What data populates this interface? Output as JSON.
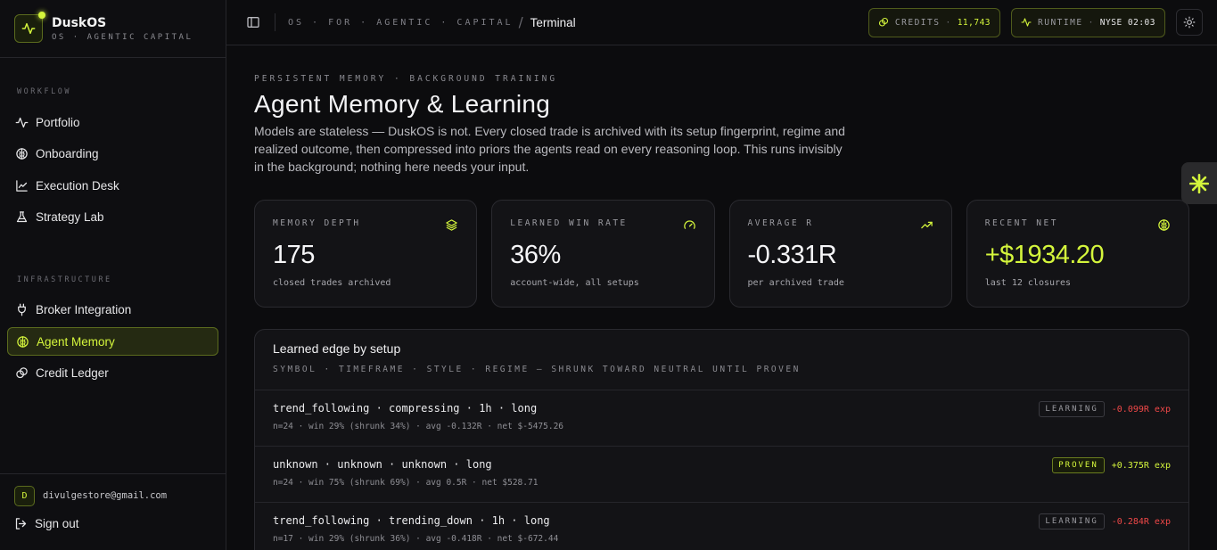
{
  "brand": {
    "name": "DuskOS",
    "subtitle": "OS · AGENTIC CAPITAL"
  },
  "sidebar": {
    "sections": [
      {
        "label": "WORKFLOW",
        "items": [
          {
            "label": "Portfolio",
            "icon": "activity-icon"
          },
          {
            "label": "Onboarding",
            "icon": "brain-icon"
          },
          {
            "label": "Execution Desk",
            "icon": "line-chart-icon"
          },
          {
            "label": "Strategy Lab",
            "icon": "flask-icon"
          }
        ]
      },
      {
        "label": "INFRASTRUCTURE",
        "items": [
          {
            "label": "Broker Integration",
            "icon": "plug-icon"
          },
          {
            "label": "Agent Memory",
            "icon": "brain-icon",
            "active": true
          },
          {
            "label": "Credit Ledger",
            "icon": "coins-icon"
          }
        ]
      }
    ],
    "user": {
      "initial": "D",
      "email": "divulgestore@gmail.com"
    },
    "signout_label": "Sign out"
  },
  "topbar": {
    "breadcrumb": "OS · FOR · AGENTIC · CAPITAL",
    "separator": "/",
    "current": "Terminal",
    "credits": {
      "label": "CREDITS",
      "value": "11,743"
    },
    "runtime": {
      "label": "RUNTIME",
      "value": "NYSE 02:03"
    }
  },
  "page": {
    "eyebrow": "PERSISTENT MEMORY · BACKGROUND TRAINING",
    "title": "Agent Memory & Learning",
    "description": "Models are stateless — DuskOS is not. Every closed trade is archived with its setup fingerprint, regime and realized outcome, then compressed into priors the agents read on every reasoning loop. This runs invisibly in the background; nothing here needs your input."
  },
  "stats": [
    {
      "label": "MEMORY DEPTH",
      "value": "175",
      "sub": "closed trades archived",
      "icon": "layers-icon"
    },
    {
      "label": "LEARNED WIN RATE",
      "value": "36%",
      "sub": "account-wide, all setups",
      "icon": "gauge-icon"
    },
    {
      "label": "AVERAGE R",
      "value": "-0.331R",
      "sub": "per archived trade",
      "icon": "trending-up-icon"
    },
    {
      "label": "RECENT NET",
      "value": "+$1934.20",
      "sub": "last 12 closures",
      "icon": "brain-icon",
      "accent": true
    }
  ],
  "edge": {
    "title": "Learned edge by setup",
    "subtitle": "SYMBOL · TIMEFRAME · STYLE · REGIME — SHRUNK TOWARD NEUTRAL UNTIL PROVEN",
    "rows": [
      {
        "title": "trend_following · compressing · 1h · long",
        "meta": "n=24 · win 29% (shrunk 34%) · avg -0.132R · net $-5475.26",
        "badge": "LEARNING",
        "exp": "-0.099R exp",
        "positive": false
      },
      {
        "title": "unknown · unknown · unknown · long",
        "meta": "n=24 · win 75% (shrunk 69%) · avg 0.5R · net $528.71",
        "badge": "PROVEN",
        "exp": "+0.375R exp",
        "positive": true
      },
      {
        "title": "trend_following · trending_down · 1h · long",
        "meta": "n=17 · win 29% (shrunk 36%) · avg -0.418R · net $-672.44",
        "badge": "LEARNING",
        "exp": "-0.284R exp",
        "positive": false
      }
    ]
  },
  "colors": {
    "accent": "#d4f53c",
    "negative": "#f04848",
    "background": "#0c0c0e"
  }
}
